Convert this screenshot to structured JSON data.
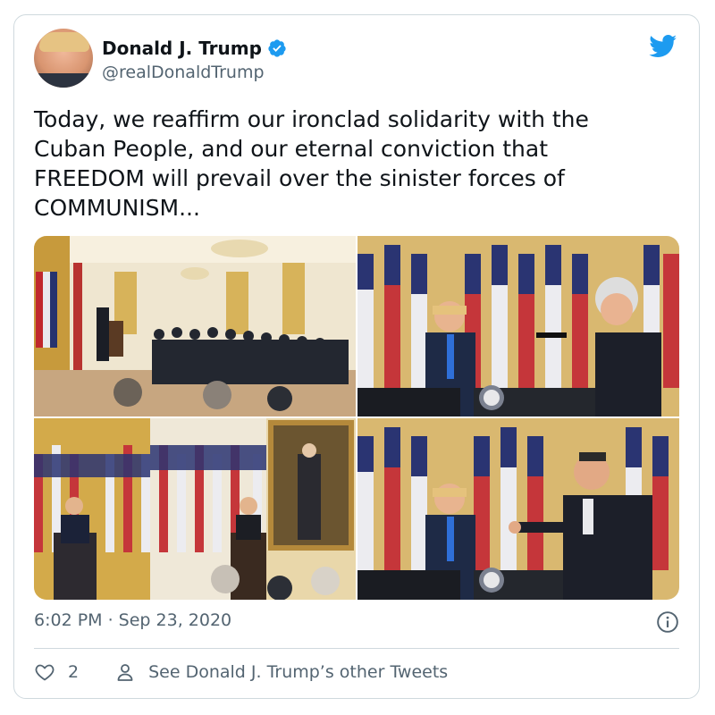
{
  "user": {
    "display_name": "Donald J. Trump",
    "handle": "@realDonaldTrump"
  },
  "tweet": {
    "text": "Today, we reaffirm our ironclad solidarity with the Cuban People, and our eternal conviction that FREEDOM will prevail over the sinister forces of COMMUNISM...",
    "timestamp": "6:02 PM · Sep 23, 2020"
  },
  "actions": {
    "like_count": "2",
    "other_tweets_label": "See Donald J. Trump’s other Tweets"
  },
  "icons": {
    "verified": "verified-badge-icon",
    "brand": "twitter-bird-icon",
    "info": "info-icon",
    "like": "heart-icon",
    "profile": "person-icon"
  },
  "colors": {
    "brand": "#1d9bf0",
    "text": "#0f1419",
    "muted": "#536471",
    "border": "#cfd9de"
  }
}
